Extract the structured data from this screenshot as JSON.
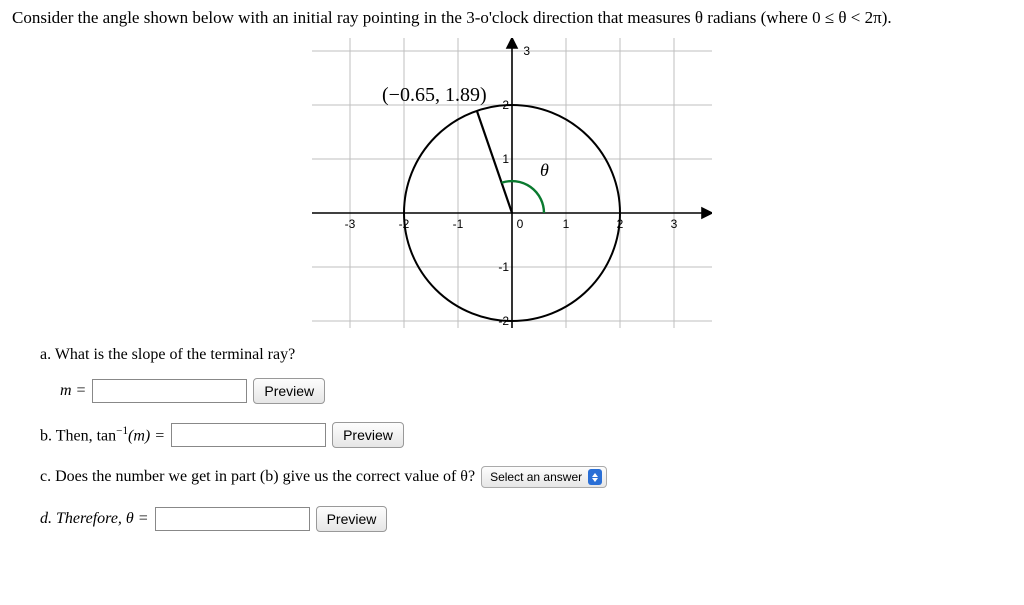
{
  "question": "Consider the angle shown below with an initial ray pointing in the 3-o'clock direction that measures θ radians (where 0 ≤ θ < 2π).",
  "parts": {
    "a": {
      "label": "a. What is the slope of the terminal ray?",
      "prefix": "m =",
      "button": "Preview"
    },
    "b": {
      "label": "b. Then, tan",
      "exp": "−1",
      "arg": "(m) =",
      "button": "Preview"
    },
    "c": {
      "label": "c. Does the number we get in part (b) give us the correct value of θ?",
      "select": "Select an answer"
    },
    "d": {
      "label": "d. Therefore, θ =",
      "button": "Preview"
    }
  },
  "chart_data": {
    "type": "scatter",
    "title": "",
    "xlabel": "",
    "ylabel": "",
    "xlim": [
      -3.5,
      3.5
    ],
    "ylim": [
      -2,
      3
    ],
    "xticks": [
      -3,
      -2,
      -1,
      0,
      1,
      2,
      3
    ],
    "yticks": [
      -2,
      -1,
      0,
      1,
      2,
      3
    ],
    "circle": {
      "cx": 0,
      "cy": 0,
      "r": 2
    },
    "point_label": "(−0.65, 1.89)",
    "point": {
      "x": -0.65,
      "y": 1.89
    },
    "theta_label": "θ",
    "initial_ray": {
      "from": [
        0,
        0
      ],
      "to": [
        3.5,
        0
      ]
    },
    "terminal_ray": {
      "from": [
        0,
        0
      ],
      "to": [
        -0.65,
        1.89
      ]
    }
  }
}
